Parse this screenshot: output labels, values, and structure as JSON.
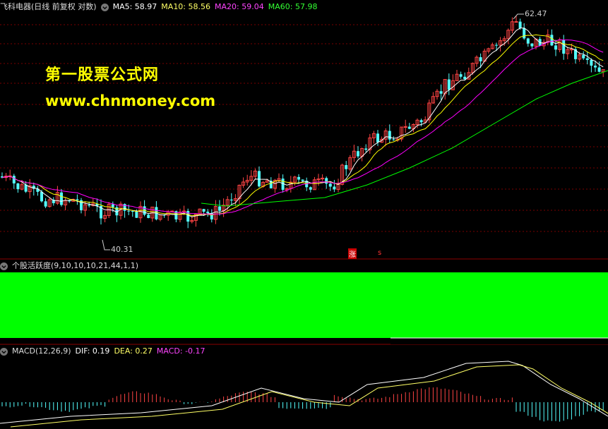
{
  "main_panel": {
    "title": "飞科电器(日线 前复权 对数)",
    "ma5": "MA5: 58.97",
    "ma10": "MA10: 58.56",
    "ma20": "MA20: 59.04",
    "ma60": "MA60: 57.98",
    "high_label": "62.47",
    "low_label": "40.31",
    "marker_zhang": "涨",
    "marker_s": "s",
    "colors": {
      "up": "#ff4444",
      "down": "#54ffff",
      "ma5": "#ffffff",
      "ma10": "#ffff00",
      "ma20": "#ff00ff",
      "ma60": "#00ff00"
    }
  },
  "watermark": {
    "line1": "第一股票公式网",
    "line2": "www.chnmoney.com"
  },
  "indicator_panel": {
    "title": "个股活跃度(9,10,10,10,21,44,1,1)",
    "bar_color": "#00ff00"
  },
  "macd_panel": {
    "title": "MACD(12,26,9)",
    "dif": "DIF: 0.19",
    "dea": "DEA: 0.27",
    "macd": "MACD: -0.17"
  },
  "icons": {
    "settings": "settings-circle-icon"
  }
}
